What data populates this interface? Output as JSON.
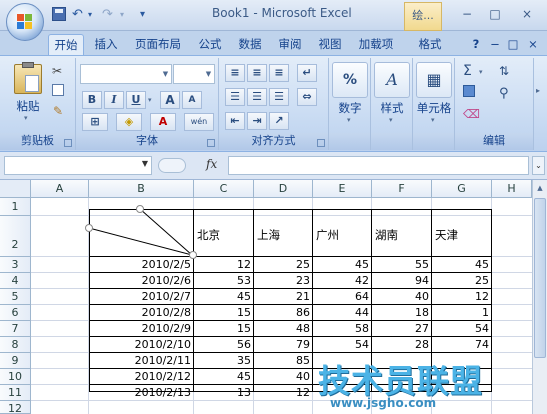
{
  "window": {
    "title": "Book1 - Microsoft Excel",
    "context_tab": "绘...",
    "controls": [
      "−",
      "□",
      "×"
    ]
  },
  "quick_access": {
    "save_icon": "save-icon",
    "undo": "↶",
    "redo": "↷",
    "menu": "▾"
  },
  "ribbon_tabs": [
    "开始",
    "插入",
    "页面布局",
    "公式",
    "数据",
    "审阅",
    "视图",
    "加载项",
    "格式"
  ],
  "active_tab": "开始",
  "ribbon": {
    "clipboard": {
      "label": "剪贴板",
      "paste": "粘贴"
    },
    "font": {
      "label": "字体",
      "font_name": "",
      "font_size": "",
      "bold": "B",
      "italic": "I",
      "underline": "U",
      "grow": "A",
      "shrink": "A",
      "phonetic": "wén"
    },
    "alignment": {
      "label": "对齐方式"
    },
    "number": {
      "label": "数字",
      "symbol": "%"
    },
    "styles": {
      "label": "样式"
    },
    "cells": {
      "label": "单元格"
    },
    "editing": {
      "label": "编辑",
      "sum": "Σ"
    }
  },
  "formula_bar": {
    "name_box": "",
    "fx": "fx",
    "formula": ""
  },
  "columns": [
    "A",
    "B",
    "C",
    "D",
    "E",
    "F",
    "G",
    "H"
  ],
  "rows": [
    "1",
    "2",
    "3",
    "4",
    "5",
    "6",
    "7",
    "8",
    "9",
    "10",
    "11",
    "12"
  ],
  "table": {
    "headers": [
      "北京",
      "上海",
      "广州",
      "湖南",
      "天津"
    ],
    "rows": [
      [
        "2010/2/5",
        "12",
        "25",
        "45",
        "55",
        "45"
      ],
      [
        "2010/2/6",
        "53",
        "23",
        "42",
        "94",
        "25"
      ],
      [
        "2010/2/7",
        "45",
        "21",
        "64",
        "40",
        "12"
      ],
      [
        "2010/2/8",
        "15",
        "86",
        "44",
        "18",
        "1"
      ],
      [
        "2010/2/9",
        "15",
        "48",
        "58",
        "27",
        "54"
      ],
      [
        "2010/2/10",
        "56",
        "79",
        "54",
        "28",
        "74"
      ],
      [
        "2010/2/11",
        "35",
        "85",
        "",
        "",
        ""
      ],
      [
        "2010/2/12",
        "45",
        "40",
        "",
        "",
        ""
      ],
      [
        "2010/2/13",
        "13",
        "12",
        "",
        "",
        ""
      ]
    ]
  },
  "watermark": {
    "text": "技术员联盟",
    "url": "www.jsgho.com"
  },
  "colors": {
    "ribbon_blue": "#bfd3ec",
    "title_text": "#3b5a86",
    "watermark": "#4bb3e6"
  }
}
